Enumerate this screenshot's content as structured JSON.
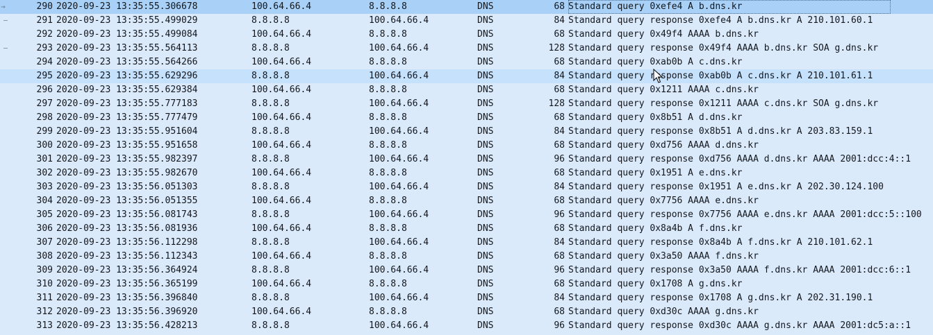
{
  "packets": [
    {
      "no": "290",
      "time": "2020-09-23 13:35:55.306678",
      "source": "100.64.66.4",
      "destination": "8.8.8.8",
      "protocol": "DNS",
      "length": "68",
      "info": "Standard query 0xefe4 A b.dns.kr",
      "related": "request"
    },
    {
      "no": "291",
      "time": "2020-09-23 13:35:55.499029",
      "source": "8.8.8.8",
      "destination": "100.64.66.4",
      "protocol": "DNS",
      "length": "84",
      "info": "Standard query response 0xefe4 A b.dns.kr A 210.101.60.1",
      "related": "response"
    },
    {
      "no": "292",
      "time": "2020-09-23 13:35:55.499084",
      "source": "100.64.66.4",
      "destination": "8.8.8.8",
      "protocol": "DNS",
      "length": "68",
      "info": "Standard query 0x49f4 AAAA b.dns.kr",
      "related": ""
    },
    {
      "no": "293",
      "time": "2020-09-23 13:35:55.564113",
      "source": "8.8.8.8",
      "destination": "100.64.66.4",
      "protocol": "DNS",
      "length": "128",
      "info": "Standard query response 0x49f4 AAAA b.dns.kr SOA g.dns.kr",
      "related": "response"
    },
    {
      "no": "294",
      "time": "2020-09-23 13:35:55.564266",
      "source": "100.64.66.4",
      "destination": "8.8.8.8",
      "protocol": "DNS",
      "length": "68",
      "info": "Standard query 0xab0b A c.dns.kr",
      "related": ""
    },
    {
      "no": "295",
      "time": "2020-09-23 13:35:55.629296",
      "source": "8.8.8.8",
      "destination": "100.64.66.4",
      "protocol": "DNS",
      "length": "84",
      "info": "Standard query response 0xab0b A c.dns.kr A 210.101.61.1",
      "related": ""
    },
    {
      "no": "296",
      "time": "2020-09-23 13:35:55.629384",
      "source": "100.64.66.4",
      "destination": "8.8.8.8",
      "protocol": "DNS",
      "length": "68",
      "info": "Standard query 0x1211 AAAA c.dns.kr",
      "related": ""
    },
    {
      "no": "297",
      "time": "2020-09-23 13:35:55.777183",
      "source": "8.8.8.8",
      "destination": "100.64.66.4",
      "protocol": "DNS",
      "length": "128",
      "info": "Standard query response 0x1211 AAAA c.dns.kr SOA g.dns.kr",
      "related": ""
    },
    {
      "no": "298",
      "time": "2020-09-23 13:35:55.777479",
      "source": "100.64.66.4",
      "destination": "8.8.8.8",
      "protocol": "DNS",
      "length": "68",
      "info": "Standard query 0x8b51 A d.dns.kr",
      "related": ""
    },
    {
      "no": "299",
      "time": "2020-09-23 13:35:55.951604",
      "source": "8.8.8.8",
      "destination": "100.64.66.4",
      "protocol": "DNS",
      "length": "84",
      "info": "Standard query response 0x8b51 A d.dns.kr A 203.83.159.1",
      "related": ""
    },
    {
      "no": "300",
      "time": "2020-09-23 13:35:55.951658",
      "source": "100.64.66.4",
      "destination": "8.8.8.8",
      "protocol": "DNS",
      "length": "68",
      "info": "Standard query 0xd756 AAAA d.dns.kr",
      "related": ""
    },
    {
      "no": "301",
      "time": "2020-09-23 13:35:55.982397",
      "source": "8.8.8.8",
      "destination": "100.64.66.4",
      "protocol": "DNS",
      "length": "96",
      "info": "Standard query response 0xd756 AAAA d.dns.kr AAAA 2001:dcc:4::1",
      "related": ""
    },
    {
      "no": "302",
      "time": "2020-09-23 13:35:55.982670",
      "source": "100.64.66.4",
      "destination": "8.8.8.8",
      "protocol": "DNS",
      "length": "68",
      "info": "Standard query 0x1951 A e.dns.kr",
      "related": ""
    },
    {
      "no": "303",
      "time": "2020-09-23 13:35:56.051303",
      "source": "8.8.8.8",
      "destination": "100.64.66.4",
      "protocol": "DNS",
      "length": "84",
      "info": "Standard query response 0x1951 A e.dns.kr A 202.30.124.100",
      "related": ""
    },
    {
      "no": "304",
      "time": "2020-09-23 13:35:56.051355",
      "source": "100.64.66.4",
      "destination": "8.8.8.8",
      "protocol": "DNS",
      "length": "68",
      "info": "Standard query 0x7756 AAAA e.dns.kr",
      "related": ""
    },
    {
      "no": "305",
      "time": "2020-09-23 13:35:56.081743",
      "source": "8.8.8.8",
      "destination": "100.64.66.4",
      "protocol": "DNS",
      "length": "96",
      "info": "Standard query response 0x7756 AAAA e.dns.kr AAAA 2001:dcc:5::100",
      "related": ""
    },
    {
      "no": "306",
      "time": "2020-09-23 13:35:56.081936",
      "source": "100.64.66.4",
      "destination": "8.8.8.8",
      "protocol": "DNS",
      "length": "68",
      "info": "Standard query 0x8a4b A f.dns.kr",
      "related": ""
    },
    {
      "no": "307",
      "time": "2020-09-23 13:35:56.112298",
      "source": "8.8.8.8",
      "destination": "100.64.66.4",
      "protocol": "DNS",
      "length": "84",
      "info": "Standard query response 0x8a4b A f.dns.kr A 210.101.62.1",
      "related": ""
    },
    {
      "no": "308",
      "time": "2020-09-23 13:35:56.112343",
      "source": "100.64.66.4",
      "destination": "8.8.8.8",
      "protocol": "DNS",
      "length": "68",
      "info": "Standard query 0x3a50 AAAA f.dns.kr",
      "related": ""
    },
    {
      "no": "309",
      "time": "2020-09-23 13:35:56.364924",
      "source": "8.8.8.8",
      "destination": "100.64.66.4",
      "protocol": "DNS",
      "length": "96",
      "info": "Standard query response 0x3a50 AAAA f.dns.kr AAAA 2001:dcc:6::1",
      "related": ""
    },
    {
      "no": "310",
      "time": "2020-09-23 13:35:56.365199",
      "source": "100.64.66.4",
      "destination": "8.8.8.8",
      "protocol": "DNS",
      "length": "68",
      "info": "Standard query 0x1708 A g.dns.kr",
      "related": ""
    },
    {
      "no": "311",
      "time": "2020-09-23 13:35:56.396840",
      "source": "8.8.8.8",
      "destination": "100.64.66.4",
      "protocol": "DNS",
      "length": "84",
      "info": "Standard query response 0x1708 A g.dns.kr A 202.31.190.1",
      "related": ""
    },
    {
      "no": "312",
      "time": "2020-09-23 13:35:56.396920",
      "source": "100.64.66.4",
      "destination": "8.8.8.8",
      "protocol": "DNS",
      "length": "68",
      "info": "Standard query 0xd30c AAAA g.dns.kr",
      "related": ""
    },
    {
      "no": "313",
      "time": "2020-09-23 13:35:56.428213",
      "source": "8.8.8.8",
      "destination": "100.64.66.4",
      "protocol": "DNS",
      "length": "96",
      "info": "Standard query response 0xd30c AAAA g.dns.kr AAAA 2001:dc5:a::1",
      "related": ""
    }
  ],
  "selected_row": "290",
  "hovered_row": "295",
  "icons": {
    "related_request": "right-arrow-icon",
    "related_response": "dash-icon",
    "cursor": "mouse-pointer-icon"
  },
  "colors": {
    "row_background": "#dbeafb",
    "selected_background": "#a9d1f7",
    "hover_background": "#c5e1fb",
    "text": "#12161c"
  }
}
